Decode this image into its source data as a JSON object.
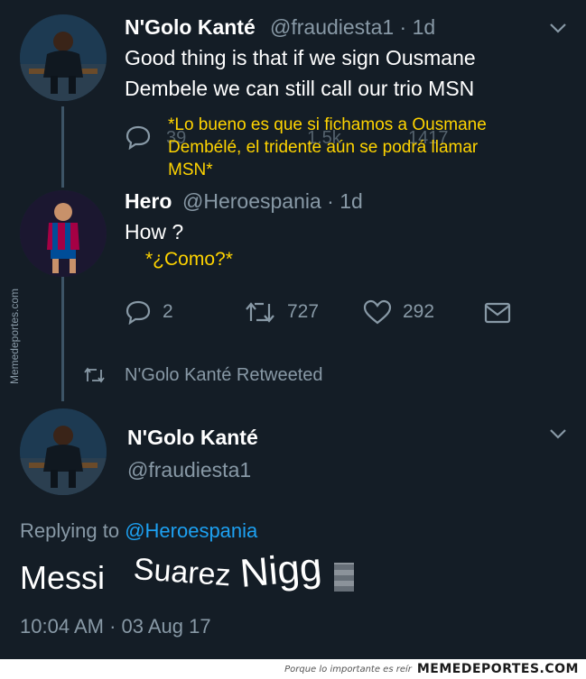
{
  "tweet1": {
    "name": "N'Golo Kanté",
    "handle": "@fraudiesta1 · 1d",
    "text_line1": "Good thing is that if we sign Ousmane",
    "text_line2": "Dembele we can still call our trio MSN",
    "caption_line1": "*Lo bueno es que si fichamos a Ousmane",
    "caption_line2": "Dembélé, el tridente aún se podrá llamar",
    "caption_line3": "MSN*",
    "ghost_replies": "39",
    "ghost_retweets": "1.5k",
    "ghost_likes": "1417"
  },
  "tweet2": {
    "name": "Hero",
    "handle": "@Heroespania · 1d",
    "text": "How ?",
    "caption": "*¿Como?*",
    "replies": "2",
    "retweets": "727",
    "likes": "292"
  },
  "retweet_notice": "N'Golo Kanté Retweeted",
  "main_tweet": {
    "name": "N'Golo Kanté",
    "handle": "@fraudiesta1",
    "replying_prefix": "Replying to ",
    "replying_to": "@Heroespania",
    "text_part1": "Messi",
    "text_part2": "Suarez",
    "text_part3": "Nigg",
    "time": "10:04 AM",
    "date": "· 03 Aug 17"
  },
  "watermark_side": "Memedeportes.com",
  "footer": {
    "slogan": "Porque lo importante es reír",
    "brand": "MEMEDEPORTES.COM"
  },
  "colors": {
    "background": "#141d26",
    "secondary_text": "#8899a6",
    "caption": "#ffd400",
    "link": "#1da1f2"
  },
  "icons": [
    "reply-icon",
    "retweet-icon",
    "like-icon",
    "dm-icon",
    "chevron-down-icon"
  ]
}
